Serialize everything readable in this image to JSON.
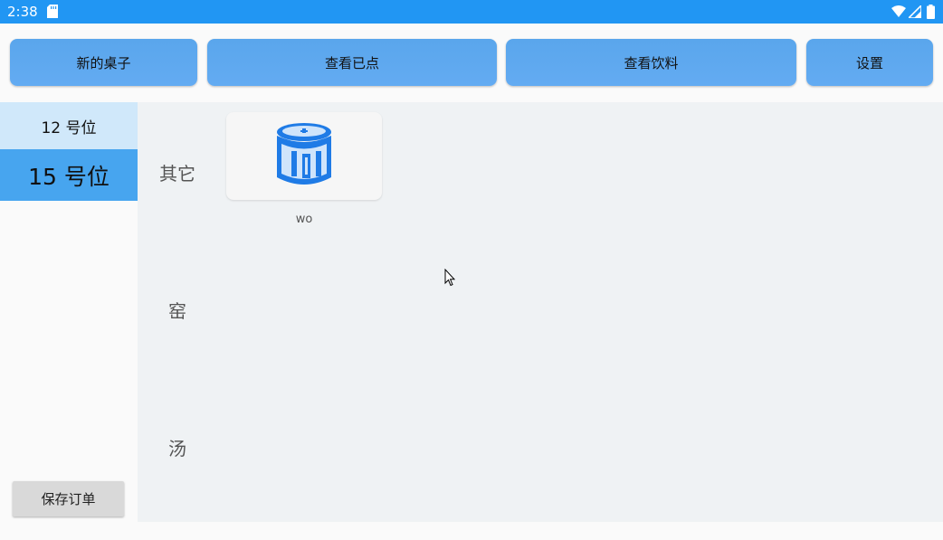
{
  "status_bar": {
    "time": "2:38",
    "icons": [
      "sd-card-icon",
      "wifi-icon",
      "signal-icon",
      "battery-icon"
    ]
  },
  "toolbar": {
    "new_table": "新的桌子",
    "view_ordered": "查看已点",
    "view_drinks": "查看饮料",
    "settings": "设置"
  },
  "sidebar": {
    "tables": [
      {
        "label": "12 号位",
        "selected": false
      },
      {
        "label": "15 号位",
        "selected": true
      }
    ],
    "save_order": "保存订单"
  },
  "main": {
    "categories": [
      "其它",
      "窑",
      "汤"
    ],
    "dishes": [
      {
        "name": "wo",
        "icon": "canister-icon"
      }
    ]
  },
  "colors": {
    "status_bar": "#2196f3",
    "toolbar_button": "#5aa6ec",
    "selected_table": "#47a5ef",
    "unselected_table": "#d0e8fa",
    "main_background": "#eff2f4",
    "icon_blue": "#1f7be6"
  }
}
